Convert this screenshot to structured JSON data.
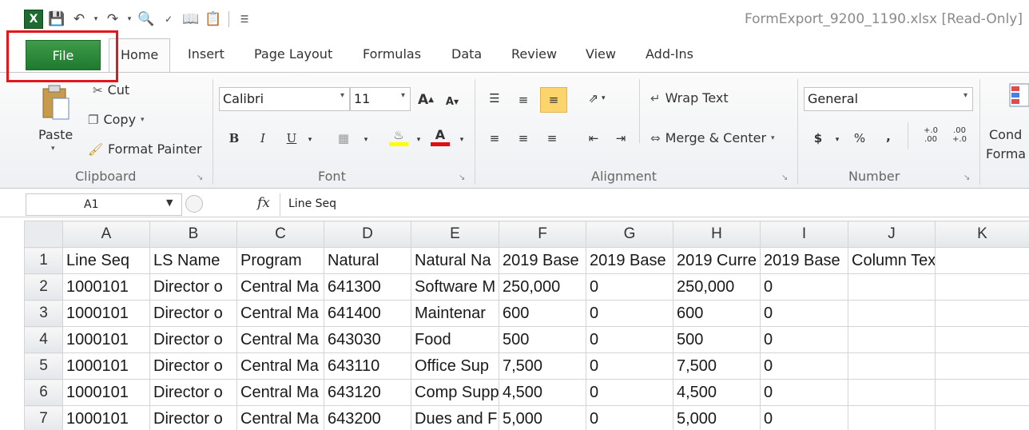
{
  "window": {
    "title": "FormExport_9200_1190.xlsx  [Read-Only]"
  },
  "quick_access": {
    "icons": [
      "excel-logo",
      "save-icon",
      "undo-icon",
      "redo-icon",
      "print-preview-icon",
      "spelling-icon",
      "research-icon",
      "paste-special-icon",
      "customize-icon"
    ]
  },
  "tabs": {
    "file": "File",
    "items": [
      {
        "label": "Home",
        "active": true
      },
      {
        "label": "Insert"
      },
      {
        "label": "Page Layout"
      },
      {
        "label": "Formulas"
      },
      {
        "label": "Data"
      },
      {
        "label": "Review"
      },
      {
        "label": "View"
      },
      {
        "label": "Add-Ins"
      }
    ]
  },
  "ribbon": {
    "clipboard": {
      "label": "Clipboard",
      "paste": "Paste",
      "cut": "Cut",
      "copy": "Copy",
      "format_painter": "Format Painter"
    },
    "font": {
      "label": "Font",
      "font_name": "Calibri",
      "font_size": "11",
      "bold": "B",
      "italic": "I",
      "underline": "U",
      "font_color": "A",
      "grow": "A",
      "shrink": "A"
    },
    "alignment": {
      "label": "Alignment",
      "wrap_text": "Wrap Text",
      "merge_center": "Merge & Center"
    },
    "number": {
      "label": "Number",
      "format": "General",
      "currency": "$",
      "percent": "%",
      "comma": ",",
      "inc_decimal_top": "+.0",
      "inc_decimal_bottom": ".00",
      "dec_decimal_top": ".00",
      "dec_decimal_bottom": "+.0"
    },
    "styles_partial": {
      "cond_line1": "Cond",
      "cond_line2": "Forma"
    }
  },
  "formula_bar": {
    "name_box": "A1",
    "fx_label": "fx",
    "content": "Line Seq"
  },
  "sheet": {
    "columns": [
      "A",
      "B",
      "C",
      "D",
      "E",
      "F",
      "G",
      "H",
      "I",
      "J",
      "K"
    ],
    "rows": [
      {
        "num": "1",
        "cells": [
          "Line Seq",
          "LS Name",
          "Program",
          "Natural",
          "Natural Na",
          "2019 Base",
          "2019 Base",
          "2019 Curre",
          "2019 Base",
          "Column Text",
          ""
        ]
      },
      {
        "num": "2",
        "cells": [
          "1000101",
          "Director o",
          "Central Ma",
          "641300",
          "Software M",
          "250,000",
          "0",
          "250,000",
          "0",
          "",
          ""
        ]
      },
      {
        "num": "3",
        "cells": [
          "1000101",
          "Director o",
          "Central Ma",
          "641400",
          "Maintenar",
          "600",
          "0",
          "600",
          "0",
          "",
          ""
        ]
      },
      {
        "num": "4",
        "cells": [
          "1000101",
          "Director o",
          "Central Ma",
          "643030",
          "Food",
          "500",
          "0",
          "500",
          "0",
          "",
          ""
        ]
      },
      {
        "num": "5",
        "cells": [
          "1000101",
          "Director o",
          "Central Ma",
          "643110",
          "Office Sup",
          "7,500",
          "0",
          "7,500",
          "0",
          "",
          ""
        ]
      },
      {
        "num": "6",
        "cells": [
          "1000101",
          "Director o",
          "Central Ma",
          "643120",
          "Comp Supp",
          "4,500",
          "0",
          "4,500",
          "0",
          "",
          ""
        ]
      },
      {
        "num": "7",
        "cells": [
          "1000101",
          "Director o",
          "Central Ma",
          "643200",
          "Dues and F",
          "5,000",
          "0",
          "5,000",
          "0",
          "",
          ""
        ]
      }
    ]
  },
  "annotation": {
    "highlight_color": "#e3161b"
  }
}
